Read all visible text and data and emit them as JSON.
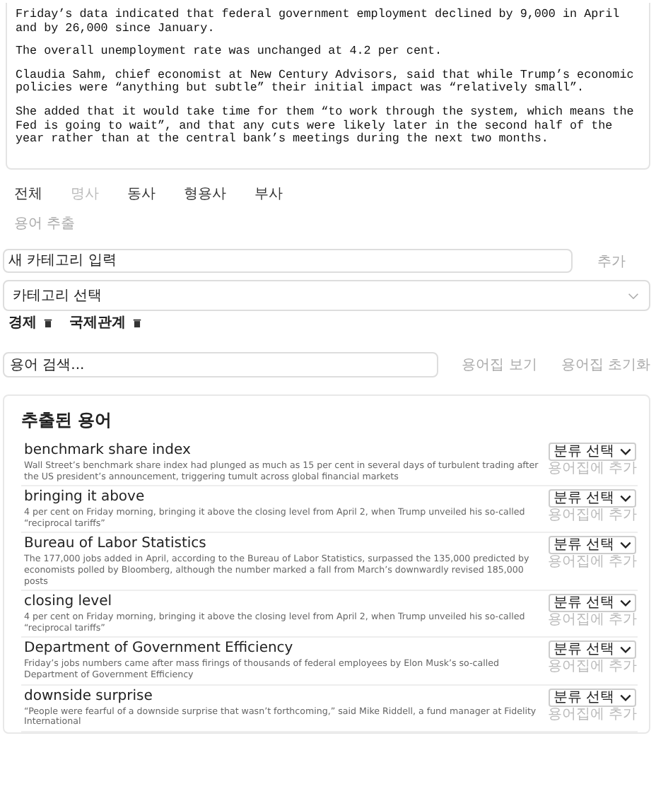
{
  "article": {
    "paragraphs": [
      "Friday’s data indicated that federal government employment declined by 9,000 in April and by 26,000 since January.",
      "The overall unemployment rate was unchanged at 4.2 per cent.",
      "Claudia Sahm, chief economist at New Century Advisors, said that while Trump’s economic policies were “anything but subtle” their initial impact was “relatively small”.",
      "She added that it would take time for them “to work through the system, which means the Fed is going to wait”, and that any cuts were likely later in the second half of the year rather than at the central bank’s meetings during the next two months."
    ]
  },
  "tabs": [
    {
      "label": "전체",
      "selected": false
    },
    {
      "label": "명사",
      "selected": true
    },
    {
      "label": "동사",
      "selected": false
    },
    {
      "label": "형용사",
      "selected": false
    },
    {
      "label": "부사",
      "selected": false
    }
  ],
  "extract_button": "용어 추출",
  "new_category": {
    "placeholder": "새 카테고리 입력",
    "button": "추가"
  },
  "category_select": {
    "placeholder": "카테고리 선택"
  },
  "categories": [
    {
      "label": "경제"
    },
    {
      "label": "국제관계"
    }
  ],
  "search": {
    "placeholder": "용어 검색...",
    "buttons": [
      "용어집 보기",
      "용어집 초기화"
    ]
  },
  "terms": {
    "title": "추출된 용어",
    "items": [
      {
        "term": "benchmark share index",
        "context": "Wall Street’s benchmark share index had plunged as much as 15 per cent in several days of turbulent trading after the US president’s announcement, triggering tumult across global financial markets",
        "select": "분류 선택",
        "add": "용어집에 추가"
      },
      {
        "term": "bringing it above",
        "context": "4 per cent on Friday morning, bringing it above the closing level from April 2, when Trump unveiled his so-called “reciprocal tariffs”",
        "select": "분류 선택",
        "add": "용어집에 추가"
      },
      {
        "term": "Bureau of Labor Statistics",
        "context": "The 177,000 jobs added in April, according to the Bureau of Labor Statistics, surpassed the 135,000 predicted by economists polled by Bloomberg, although the number marked a fall from March’s downwardly revised 185,000 posts",
        "select": "분류 선택",
        "add": "용어집에 추가"
      },
      {
        "term": "closing level",
        "context": "4 per cent on Friday morning, bringing it above the closing level from April 2, when Trump unveiled his so-called “reciprocal tariffs”",
        "select": "분류 선택",
        "add": "용어집에 추가"
      },
      {
        "term": "Department of Government Efficiency",
        "context": "Friday’s jobs numbers came after mass firings of thousands of federal employees by Elon Musk’s so-called Department of Government Efficiency",
        "select": "분류 선택",
        "add": "용어집에 추가"
      },
      {
        "term": "downside surprise",
        "context": "“People were fearful of a downside surprise that wasn’t forthcoming,” said Mike Riddell, a fund manager at Fidelity International",
        "select": "분류 선택",
        "add": "용어집에 추가"
      }
    ]
  }
}
